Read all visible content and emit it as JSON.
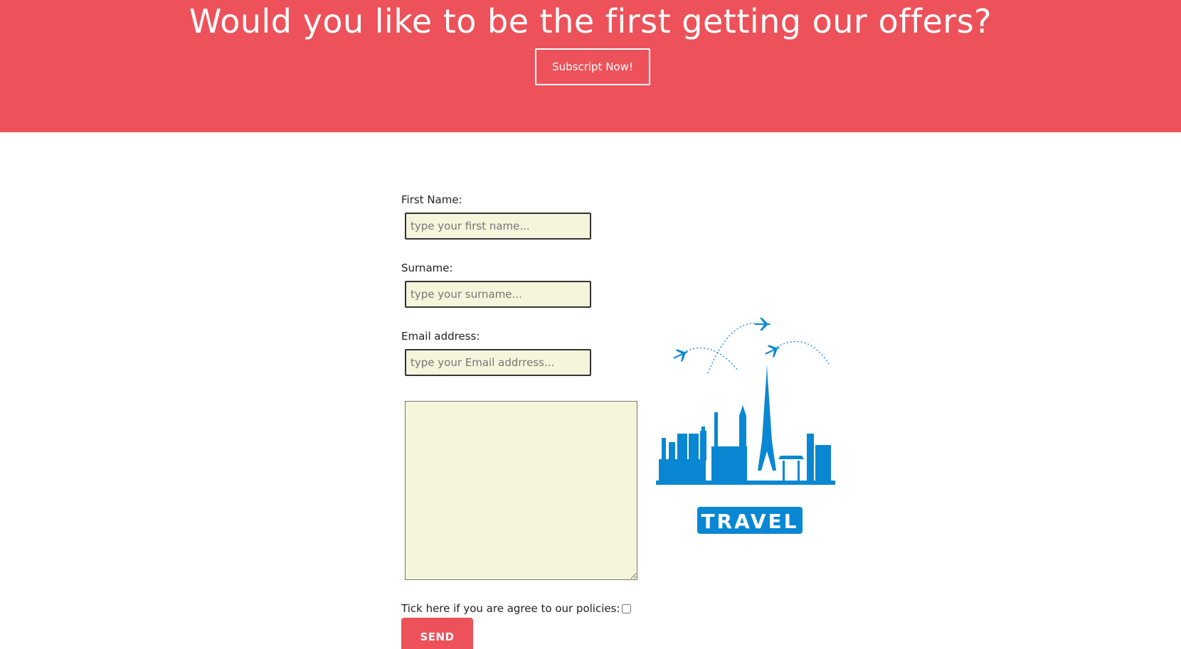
{
  "banner": {
    "title": "Would you like to be the first getting our offers?",
    "subscribe_label": "Subscript Now!",
    "background": "#ed525a"
  },
  "form": {
    "first_name": {
      "label": "First Name:",
      "placeholder": "type your first name...",
      "value": ""
    },
    "surname": {
      "label": "Surname:",
      "placeholder": "type your surname...",
      "value": ""
    },
    "email": {
      "label": "Email address:",
      "placeholder": "type your Email addrress...",
      "value": ""
    },
    "message": {
      "value": ""
    },
    "policy_label": "Tick here if you are agree to our policies:",
    "policy_checked": false,
    "send_label": "SEND",
    "input_background": "#f5f5dc"
  },
  "illustration": {
    "logo_text": "TRAVEL",
    "color": "#0a87d2",
    "icons": [
      "airplane-icon",
      "skyline-icon"
    ]
  }
}
